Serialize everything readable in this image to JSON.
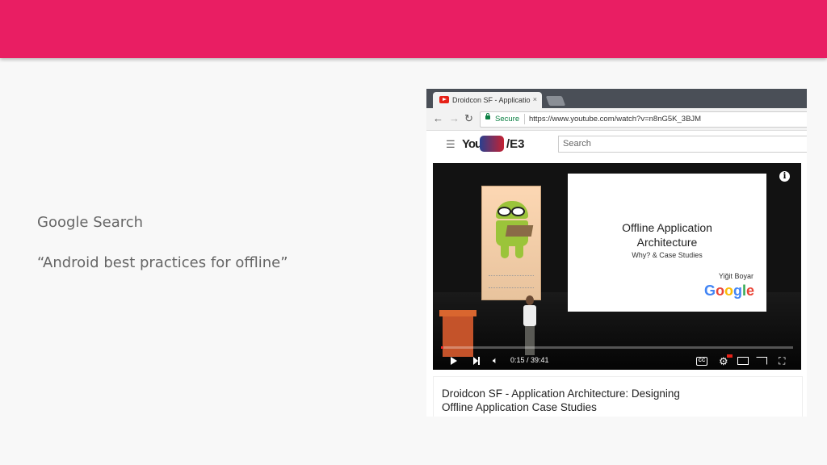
{
  "slide": {
    "line1": "Google Search",
    "line2": "“Android best practices for offline”"
  },
  "browser": {
    "tab_title": "Droidcon SF - Applicatio",
    "tab_close": "×",
    "security_label": "Secure",
    "url": "https://www.youtube.com/watch?v=n8nG5K_3BJM"
  },
  "youtube": {
    "logo_you": "You",
    "logo_suffix": "/E3",
    "search_placeholder": "Search",
    "video": {
      "slide_title_line1": "Offline Application",
      "slide_title_line2": "Architecture",
      "slide_subtitle": "Why? & Case Studies",
      "speaker_name": "Yiğit Boyar",
      "company_logo": "Google",
      "time": "0:15 / 39:41",
      "progress_fraction": 0.006
    },
    "video_title_line1": "Droidcon SF - Application Architecture: Designing",
    "video_title_line2": "Offline Application Case Studies"
  },
  "colors": {
    "accent": "#e91e63",
    "youtube_red": "#e62117",
    "secure_green": "#0b8043"
  }
}
